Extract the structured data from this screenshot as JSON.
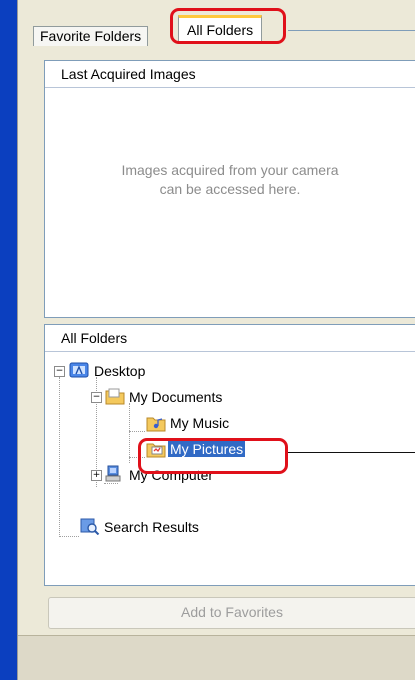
{
  "tabs": {
    "favorite_folders": "Favorite Folders",
    "all_folders": "All Folders"
  },
  "last_acquired": {
    "title": "Last Acquired Images",
    "message_line1": "Images acquired from your camera",
    "message_line2": "can be accessed here."
  },
  "all_folders_panel": {
    "title": "All Folders",
    "tree": [
      {
        "label": "Desktop",
        "icon": "desktop-icon",
        "expanded": true
      },
      {
        "label": "My Documents",
        "icon": "folder-icon",
        "expanded": true
      },
      {
        "label": "My Music",
        "icon": "music-folder-icon"
      },
      {
        "label": "My Pictures",
        "icon": "pictures-folder-icon",
        "selected": true
      },
      {
        "label": "My Computer",
        "icon": "computer-icon",
        "expanded": false
      },
      {
        "label": "Search Results",
        "icon": "search-results-icon"
      }
    ]
  },
  "buttons": {
    "add_to_favorites": "Add to Favorites"
  },
  "colors": {
    "highlight": "#e0101a",
    "selection": "#316ac5",
    "border": "#7f9db9"
  }
}
